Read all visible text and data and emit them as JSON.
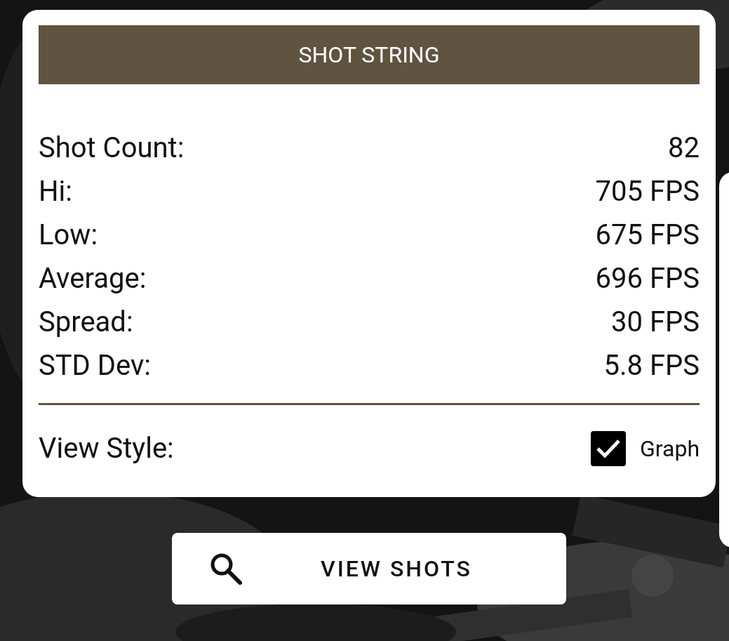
{
  "header": {
    "title": "SHOT STRING"
  },
  "stats": [
    {
      "label": "Shot Count:",
      "value": "82"
    },
    {
      "label": "Hi:",
      "value": "705 FPS"
    },
    {
      "label": "Low:",
      "value": "675 FPS"
    },
    {
      "label": "Average:",
      "value": "696 FPS"
    },
    {
      "label": "Spread:",
      "value": "30 FPS"
    },
    {
      "label": "STD Dev:",
      "value": "5.8 FPS"
    }
  ],
  "view_style": {
    "label": "View Style:",
    "option": "Graph",
    "checked": true
  },
  "button": {
    "label": "VIEW SHOTS"
  }
}
